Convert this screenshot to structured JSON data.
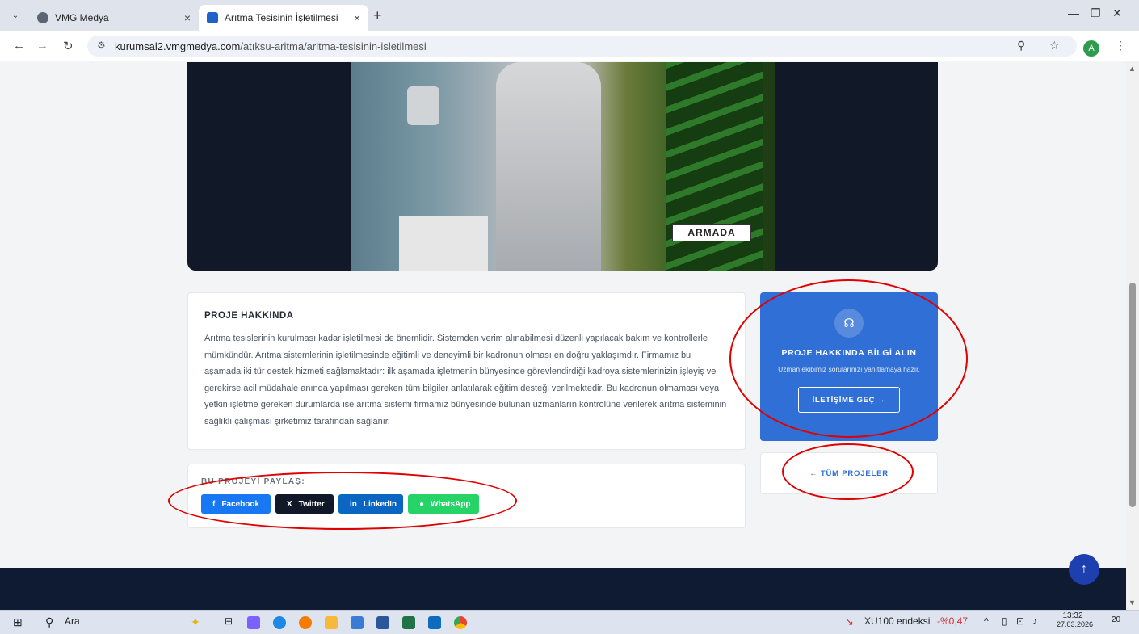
{
  "browser": {
    "tabs": [
      {
        "title": "VMG Medya",
        "close": "×"
      },
      {
        "title": "Arıtma Tesisinin İşletilmesi",
        "close": "×"
      }
    ],
    "new_tab": "+",
    "url_host": "kurumsal2.vmgmedya.com",
    "url_path": "/atıksu-aritma/aritma-tesisinin-isletilmesi",
    "profile_initial": "A"
  },
  "hero": {
    "logo_text": "ARMADA"
  },
  "about": {
    "heading": "PROJE HAKKINDA",
    "body": "Arıtma tesislerinin kurulması kadar işletilmesi de önemlidir. Sistemden verim alınabilmesi düzenli yapılacak bakım ve kontrollerle mümkündür. Arıtma sistemlerinin işletilmesinde eğitimli ve deneyimli bir kadronun olması en doğru yaklaşımdır. Firmamız bu aşamada iki tür destek hizmeti sağlamaktadır: ilk aşamada işletmenin bünyesinde görevlendirdiği kadroya sistemlerinizin işleyiş ve gerekirse acil müdahale anında yapılması gereken tüm bilgiler anlatılarak eğitim desteği verilmektedir. Bu kadronun olmaması veya yetkin işletme gereken durumlarda ise arıtma sistemi firmamız bünyesinde bulunan uzmanların kontrolüne verilerek arıtma sisteminin sağlıklı çalışması şirketimiz tarafından sağlanır."
  },
  "share": {
    "label": "BU PROJEYİ PAYLAŞ:",
    "buttons": [
      {
        "label": "Facebook",
        "icon": "f"
      },
      {
        "label": "Twitter",
        "icon": "X"
      },
      {
        "label": "LinkedIn",
        "icon": "in"
      },
      {
        "label": "WhatsApp",
        "icon": "●"
      }
    ]
  },
  "cta": {
    "title": "PROJE HAKKINDA BİLGİ ALIN",
    "subtitle": "Uzman ekibimiz sorularınızı yanıtlamaya hazır.",
    "button": "İLETİŞİME GEÇ →"
  },
  "all_projects": "← TÜM PROJELER",
  "taskbar": {
    "search": "Ara",
    "stock": "XU100 endeksi",
    "stock_change": "-%0,47",
    "time": "13:32",
    "date": "27.03.2026",
    "notifications": "20"
  },
  "colors": {
    "accent": "#2f6fd6",
    "facebook": "#1877f2",
    "linkedin": "#0a66c2",
    "whatsapp": "#25d366",
    "annotation": "#e00000"
  }
}
